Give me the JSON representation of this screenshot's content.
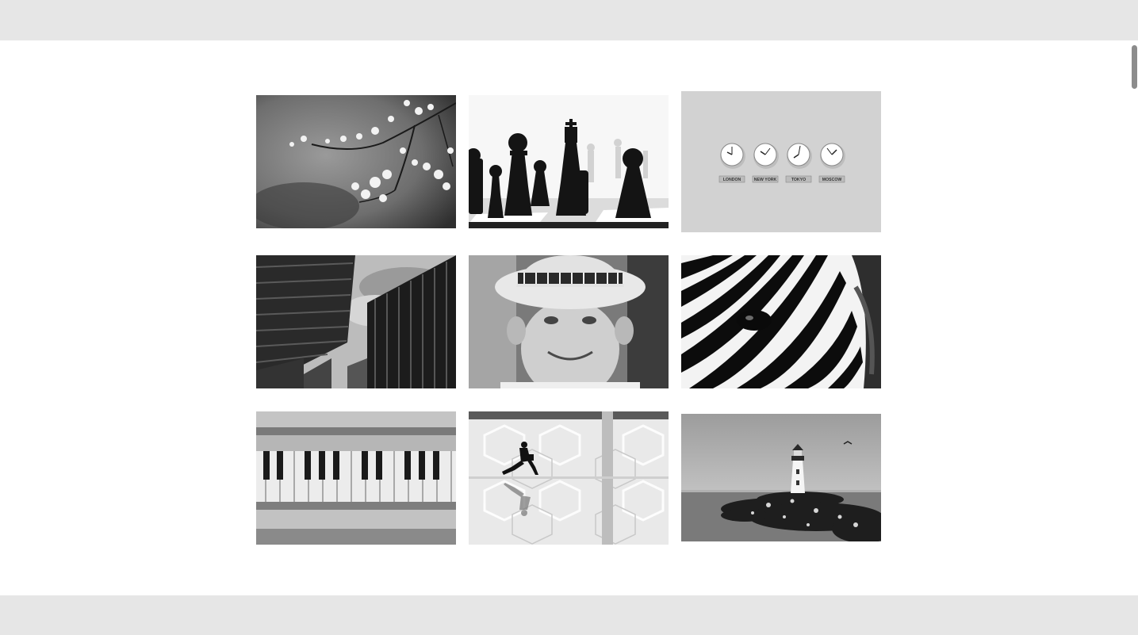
{
  "colors": {
    "bars": "#e6e6e6",
    "background": "#ffffff",
    "scrollbar": "#8c8c8c"
  },
  "gallery": {
    "images": [
      {
        "name": "cherry-blossom-photo"
      },
      {
        "name": "chess-pieces-photo"
      },
      {
        "name": "world-clocks-photo"
      },
      {
        "name": "skyscrapers-photo"
      },
      {
        "name": "smiling-boy-photo"
      },
      {
        "name": "zebra-photo"
      },
      {
        "name": "piano-keys-photo"
      },
      {
        "name": "running-man-photo"
      },
      {
        "name": "lighthouse-photo"
      }
    ],
    "clock_labels": [
      "LONDON",
      "NEW YORK",
      "TOKYO",
      "MOSCOW"
    ]
  }
}
